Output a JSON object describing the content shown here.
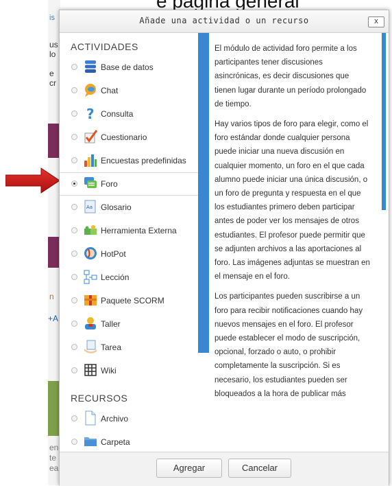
{
  "background": {
    "top_text": "e página general",
    "side_texts": [
      "is",
      "us",
      "lo",
      "e",
      "cr",
      "n",
      "+A",
      "en",
      "te",
      "ea"
    ]
  },
  "modal": {
    "title": "Añade una actividad o un recurso",
    "close_label": "x",
    "sections": [
      {
        "title": "ACTIVIDADES",
        "items": [
          {
            "label": "Base de datos",
            "icon": "database-icon",
            "selected": false
          },
          {
            "label": "Chat",
            "icon": "chat-icon",
            "selected": false
          },
          {
            "label": "Consulta",
            "icon": "question-icon",
            "selected": false
          },
          {
            "label": "Cuestionario",
            "icon": "quiz-checkmark-icon",
            "selected": false
          },
          {
            "label": "Encuestas predefinidas",
            "icon": "survey-chart-icon",
            "selected": false
          },
          {
            "label": "Foro",
            "icon": "forum-icon",
            "selected": true
          },
          {
            "label": "Glosario",
            "icon": "glossary-icon",
            "selected": false
          },
          {
            "label": "Herramienta Externa",
            "icon": "puzzle-icon",
            "selected": false
          },
          {
            "label": "HotPot",
            "icon": "hotpot-icon",
            "selected": false
          },
          {
            "label": "Lección",
            "icon": "lesson-icon",
            "selected": false
          },
          {
            "label": "Paquete SCORM",
            "icon": "scorm-package-icon",
            "selected": false
          },
          {
            "label": "Taller",
            "icon": "workshop-icon",
            "selected": false
          },
          {
            "label": "Tarea",
            "icon": "assignment-icon",
            "selected": false
          },
          {
            "label": "Wiki",
            "icon": "wiki-icon",
            "selected": false
          }
        ]
      },
      {
        "title": "RECURSOS",
        "items": [
          {
            "label": "Archivo",
            "icon": "file-icon",
            "selected": false
          },
          {
            "label": "Carpeta",
            "icon": "folder-icon",
            "selected": false
          }
        ]
      }
    ],
    "description": [
      "El módulo de actividad foro permite a los participantes tener discusiones asincrónicas, es decir discusiones que tienen lugar durante un período prolongado de tiempo.",
      "Hay varios tipos de foro para elegir, como el foro estándar donde cualquier persona puede iniciar una nueva discusión en cualquier momento, un foro en el que cada alumno puede iniciar una única discusión, o un foro de pregunta y respuesta en el que los estudiantes primero deben participar antes de poder ver los mensajes de otros estudiantes. El profesor puede permitir que se adjunten archivos a las aportaciones al foro. Las imágenes adjuntas se muestran en el mensaje en el foro.",
      "Los participantes pueden suscribirse a un foro para recibir notificaciones cuando hay nuevos mensajes en el foro. El profesor puede establecer el modo de suscripción, opcional, forzado o auto, o prohibir completamente la suscripción. Si es necesario, los estudiantes pueden ser bloqueados a la hora de publicar más"
    ],
    "buttons": {
      "add": "Agregar",
      "cancel": "Cancelar"
    }
  },
  "colors": {
    "accent_blue": "#3a87d1",
    "arrow_red": "#d0201c"
  }
}
